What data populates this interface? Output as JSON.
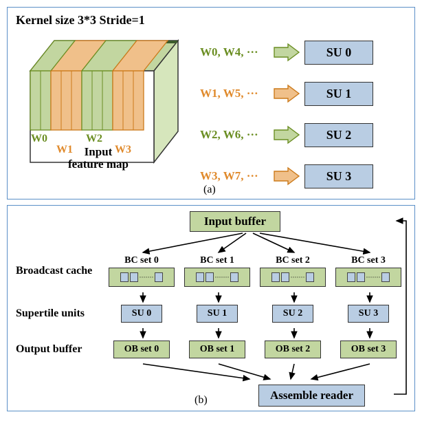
{
  "title": "Kernel size 3*3  Stride=1",
  "feature_map": {
    "windows": [
      "W0",
      "W1",
      "W2",
      "W3"
    ],
    "caption_line1": "Input",
    "caption_line2": "feature map"
  },
  "dispatch": [
    {
      "wins": "W0, W4, ···",
      "su": "SU 0",
      "color": "green"
    },
    {
      "wins": "W1, W5, ···",
      "su": "SU 1",
      "color": "orange"
    },
    {
      "wins": "W2, W6, ···",
      "su": "SU 2",
      "color": "green"
    },
    {
      "wins": "W3, W7, ···",
      "su": "SU 3",
      "color": "orange"
    }
  ],
  "panel_a_label": "(a)",
  "panel_b_label": "(b)",
  "panel_b": {
    "input_buffer": "Input buffer",
    "labels": {
      "broadcast": "Broadcast cache",
      "supertile": "Supertile units",
      "output": "Output buffer"
    },
    "columns": [
      {
        "bc": "BC set 0",
        "su": "SU 0",
        "ob": "OB set 0"
      },
      {
        "bc": "BC set 1",
        "su": "SU 1",
        "ob": "OB set 1"
      },
      {
        "bc": "BC set 2",
        "su": "SU 2",
        "ob": "OB set 2"
      },
      {
        "bc": "BC set 3",
        "su": "SU 3",
        "ob": "OB set 3"
      }
    ],
    "assemble": "Assemble reader"
  }
}
